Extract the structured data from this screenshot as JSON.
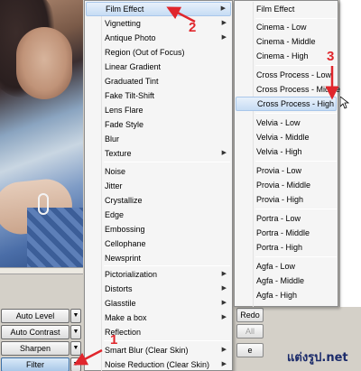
{
  "left_buttons": [
    {
      "label": "Auto Level"
    },
    {
      "label": "Auto Contrast"
    },
    {
      "label": "Sharpen"
    },
    {
      "label": "Filter"
    }
  ],
  "menu": {
    "items": [
      {
        "label": "Film Effect",
        "submenu": true
      },
      {
        "label": "Vignetting",
        "submenu": true
      },
      {
        "label": "Antique Photo",
        "submenu": true
      },
      {
        "label": "Region (Out of Focus)",
        "submenu": false
      },
      {
        "label": "Linear Gradient",
        "submenu": false
      },
      {
        "label": "Graduated Tint",
        "submenu": false
      },
      {
        "label": "Fake Tilt-Shift",
        "submenu": false
      },
      {
        "label": "Lens Flare",
        "submenu": false
      },
      {
        "label": "Fade Style",
        "submenu": false
      },
      {
        "label": "Blur",
        "submenu": false
      },
      {
        "label": "Texture",
        "submenu": true
      },
      {
        "label": "Noise",
        "submenu": false
      },
      {
        "label": "Jitter",
        "submenu": false
      },
      {
        "label": "Crystallize",
        "submenu": false
      },
      {
        "label": "Edge",
        "submenu": false
      },
      {
        "label": "Embossing",
        "submenu": false
      },
      {
        "label": "Cellophane",
        "submenu": false
      },
      {
        "label": "Newsprint",
        "submenu": false
      },
      {
        "label": "Pictorialization",
        "submenu": true
      },
      {
        "label": "Distorts",
        "submenu": true
      },
      {
        "label": "Glasstile",
        "submenu": true
      },
      {
        "label": "Make a box",
        "submenu": true
      },
      {
        "label": "Reflection",
        "submenu": false
      },
      {
        "label": "Smart Blur (Clear Skin)",
        "submenu": true
      },
      {
        "label": "Noise Reduction (Clear Skin)",
        "submenu": true
      }
    ]
  },
  "submenu": {
    "items": [
      {
        "label": "Film Effect"
      },
      {
        "label": "Cinema - Low"
      },
      {
        "label": "Cinema - Middle"
      },
      {
        "label": "Cinema - High"
      },
      {
        "label": "Cross Process - Low"
      },
      {
        "label": "Cross Process - Middle"
      },
      {
        "label": "Cross Process - High"
      },
      {
        "label": "Velvia - Low"
      },
      {
        "label": "Velvia - Middle"
      },
      {
        "label": "Velvia - High"
      },
      {
        "label": "Provia - Low"
      },
      {
        "label": "Provia - Middle"
      },
      {
        "label": "Provia - High"
      },
      {
        "label": "Portra - Low"
      },
      {
        "label": "Portra - Middle"
      },
      {
        "label": "Portra - High"
      },
      {
        "label": "Agfa - Low"
      },
      {
        "label": "Agfa - Middle"
      },
      {
        "label": "Agfa - High"
      }
    ]
  },
  "right_buttons": {
    "redo": "Redo",
    "all": "All",
    "e": "e"
  },
  "annotations": {
    "step1": "1",
    "step2": "2",
    "step3": "3",
    "watermark": "แต่งรูป.net"
  },
  "colors": {
    "annotation_red": "#e0262c",
    "highlight": "#c6dcf4"
  },
  "icons": {
    "submenu_arrow": "triangle-right",
    "dropdown_arrow": "triangle-down",
    "cursor": "mouse-pointer-icon"
  }
}
